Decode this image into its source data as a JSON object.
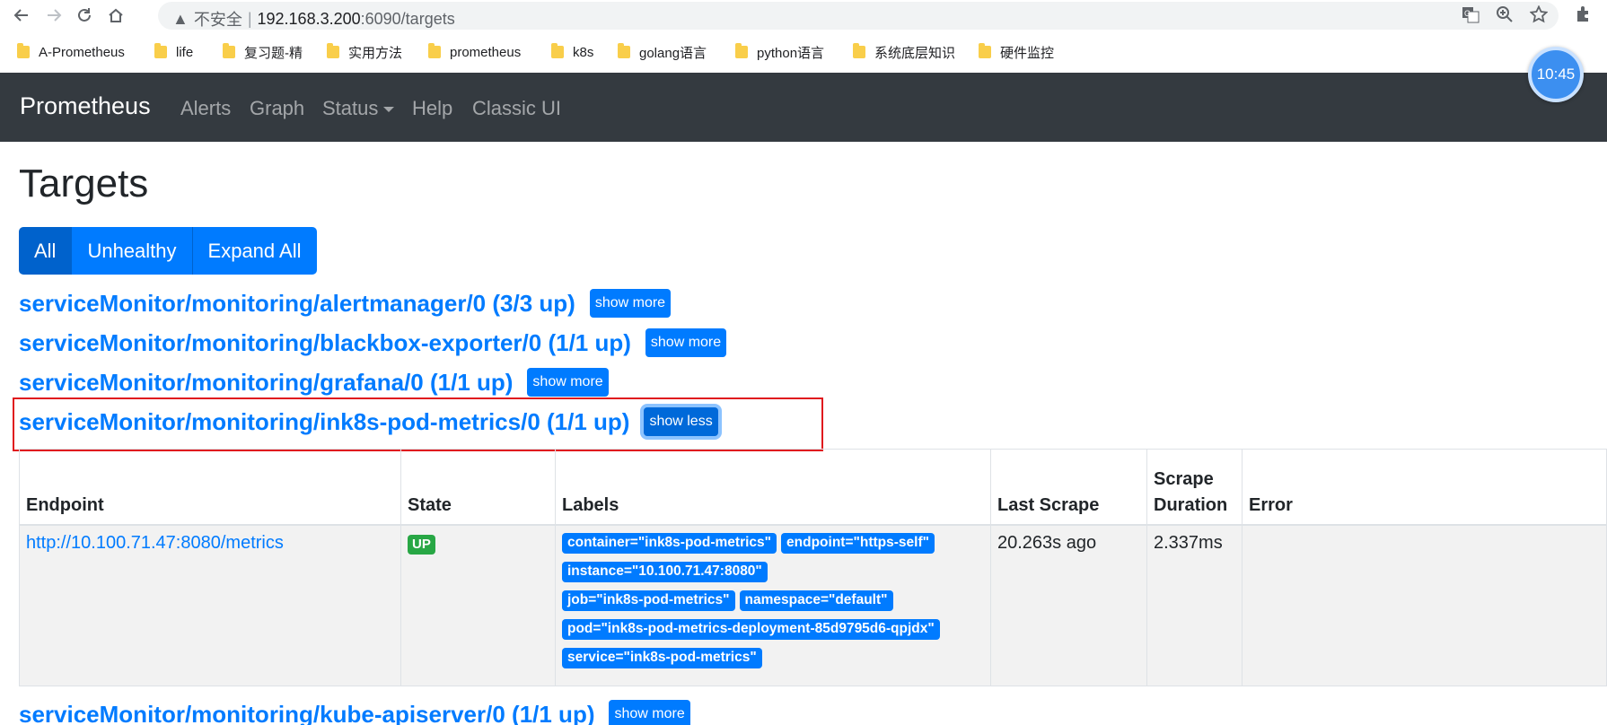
{
  "browser": {
    "insecure_label": "不安全",
    "separator": "|",
    "url_host": "192.168.3.200",
    "url_path": ":6090/targets",
    "bookmarks": [
      {
        "label": "A-Prometheus"
      },
      {
        "label": "life"
      },
      {
        "label": "复习题-精"
      },
      {
        "label": "实用方法"
      },
      {
        "label": "prometheus"
      },
      {
        "label": "k8s"
      },
      {
        "label": "golang语言"
      },
      {
        "label": "python语言"
      },
      {
        "label": "系统底层知识"
      },
      {
        "label": "硬件监控"
      }
    ],
    "clock": "10:45"
  },
  "navbar": {
    "brand": "Prometheus",
    "links": [
      {
        "label": "Alerts"
      },
      {
        "label": "Graph"
      },
      {
        "label": "Status"
      },
      {
        "label": "Help"
      },
      {
        "label": "Classic UI"
      }
    ]
  },
  "page": {
    "title": "Targets",
    "filters": [
      {
        "label": "All",
        "active": true
      },
      {
        "label": "Unhealthy",
        "active": false
      },
      {
        "label": "Expand All",
        "active": false
      }
    ]
  },
  "pools": [
    {
      "name": "serviceMonitor/monitoring/alertmanager/0 (3/3 up)",
      "button": "show more"
    },
    {
      "name": "serviceMonitor/monitoring/blackbox-exporter/0 (1/1 up)",
      "button": "show more"
    },
    {
      "name": "serviceMonitor/monitoring/grafana/0 (1/1 up)",
      "button": "show more"
    },
    {
      "name": "serviceMonitor/monitoring/ink8s-pod-metrics/0 (1/1 up)",
      "button": "show less"
    },
    {
      "name": "serviceMonitor/monitoring/kube-apiserver/0 (1/1 up)",
      "button": "show more"
    }
  ],
  "table": {
    "headers": {
      "endpoint": "Endpoint",
      "state": "State",
      "labels": "Labels",
      "last_scrape": "Last Scrape",
      "scrape_duration_1": "Scrape",
      "scrape_duration_2": "Duration",
      "error": "Error"
    },
    "row": {
      "endpoint": "http://10.100.71.47:8080/metrics",
      "state": "UP",
      "labels": [
        "container=\"ink8s-pod-metrics\"",
        "endpoint=\"https-self\"",
        "instance=\"10.100.71.47:8080\"",
        "job=\"ink8s-pod-metrics\"",
        "namespace=\"default\"",
        "pod=\"ink8s-pod-metrics-deployment-85d9795d6-qpjdx\"",
        "service=\"ink8s-pod-metrics\""
      ],
      "last_scrape": "20.263s ago",
      "scrape_duration": "2.337ms",
      "error": ""
    }
  },
  "colors": {
    "link": "#007bff",
    "navbar": "#343a40",
    "up": "#28a745",
    "highlight": "#e0191e"
  }
}
